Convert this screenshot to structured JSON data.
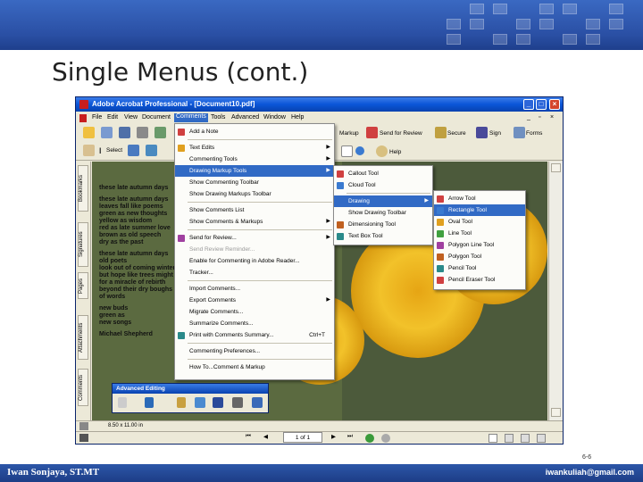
{
  "slide": {
    "title": "Single Menus (cont.)",
    "footer_left": "Iwan Sonjaya, ST.MT",
    "footer_right": "iwankuliah@gmail.com",
    "page_number": "6-6"
  },
  "window": {
    "title": "Adobe Acrobat Professional - [Document10.pdf]",
    "menus": [
      "File",
      "Edit",
      "View",
      "Document",
      "Comments",
      "Tools",
      "Advanced",
      "Window",
      "Help"
    ],
    "toolbar": {
      "select_label": "Select",
      "markup_label": "Markup",
      "send_for_review": "Send for Review",
      "secure": "Secure",
      "sign": "Sign",
      "forms": "Forms",
      "help": "Help"
    },
    "side_tabs": [
      "Bookmarks",
      "Signatures",
      "Pages",
      "Attachments",
      "Comments"
    ],
    "page_size": "8.50 x 11.00 in",
    "page_counter": "1 of 1",
    "advanced_editing_title": "Advanced Editing"
  },
  "document": {
    "poem_lines": [
      "these late autumn days",
      "",
      "these late autumn days",
      "leaves fall like poems",
      "green as new thoughts",
      "yellow as wisdom",
      "red as late summer love",
      "brown as old speech",
      "dry as the past",
      "",
      "these late autumn days",
      "old poets",
      "look out of coming winter",
      "but hope like trees might",
      "for a miracle of rebirth",
      "beyond their dry boughs",
      "of words",
      "",
      "new buds",
      "green as",
      "new songs",
      "",
      "Michael Shepherd"
    ]
  },
  "comments_menu": [
    {
      "label": "Add a Note",
      "icon": "note-icon"
    },
    {
      "sep": true
    },
    {
      "label": "Text Edits",
      "submenu": true,
      "icon": "text-edit-icon"
    },
    {
      "label": "Commenting Tools",
      "submenu": true
    },
    {
      "label": "Drawing Markup Tools",
      "submenu": true,
      "highlighted": true
    },
    {
      "label": "Show Commenting Toolbar"
    },
    {
      "label": "Show Drawing Markups Toolbar"
    },
    {
      "sep": true
    },
    {
      "label": "Show Comments List"
    },
    {
      "label": "Show Comments & Markups",
      "submenu": true
    },
    {
      "sep": true
    },
    {
      "label": "Send for Review...",
      "submenu": true,
      "icon": "send-review-icon"
    },
    {
      "label": "Send Review Reminder...",
      "disabled": true
    },
    {
      "label": "Enable for Commenting in Adobe Reader..."
    },
    {
      "label": "Tracker..."
    },
    {
      "sep": true
    },
    {
      "label": "Import Comments..."
    },
    {
      "label": "Export Comments",
      "submenu": true
    },
    {
      "label": "Migrate Comments..."
    },
    {
      "label": "Summarize Comments..."
    },
    {
      "label": "Print with Comments Summary...",
      "shortcut": "Ctrl+T",
      "icon": "print-icon"
    },
    {
      "sep": true
    },
    {
      "label": "Commenting Preferences..."
    },
    {
      "sep": true
    },
    {
      "label": "How To...Comment & Markup"
    }
  ],
  "drawing_markup_menu": [
    {
      "label": "Callout Tool",
      "icon": "callout-icon"
    },
    {
      "label": "Cloud Tool",
      "icon": "cloud-icon"
    },
    {
      "sep": true
    },
    {
      "label": "Drawing",
      "submenu": true,
      "highlighted": true
    },
    {
      "label": "Show Drawing Toolbar"
    },
    {
      "label": "Dimensioning Tool",
      "icon": "dimension-icon"
    },
    {
      "label": "Text Box Tool",
      "icon": "textbox-icon"
    }
  ],
  "drawing_menu": [
    {
      "label": "Arrow Tool",
      "icon": "arrow-tool-icon"
    },
    {
      "label": "Rectangle Tool",
      "icon": "rectangle-tool-icon",
      "highlighted": true
    },
    {
      "label": "Oval Tool",
      "icon": "oval-tool-icon"
    },
    {
      "label": "Line Tool",
      "icon": "line-tool-icon"
    },
    {
      "label": "Polygon Line Tool",
      "icon": "polygon-line-icon"
    },
    {
      "label": "Polygon Tool",
      "icon": "polygon-icon"
    },
    {
      "label": "Pencil Tool",
      "icon": "pencil-icon"
    },
    {
      "label": "Pencil Eraser Tool",
      "icon": "eraser-icon"
    }
  ],
  "colors": {
    "header_blue": "#2a4fa4",
    "menu_highlight": "#316ac5",
    "title_bar": "#0a55d8"
  }
}
